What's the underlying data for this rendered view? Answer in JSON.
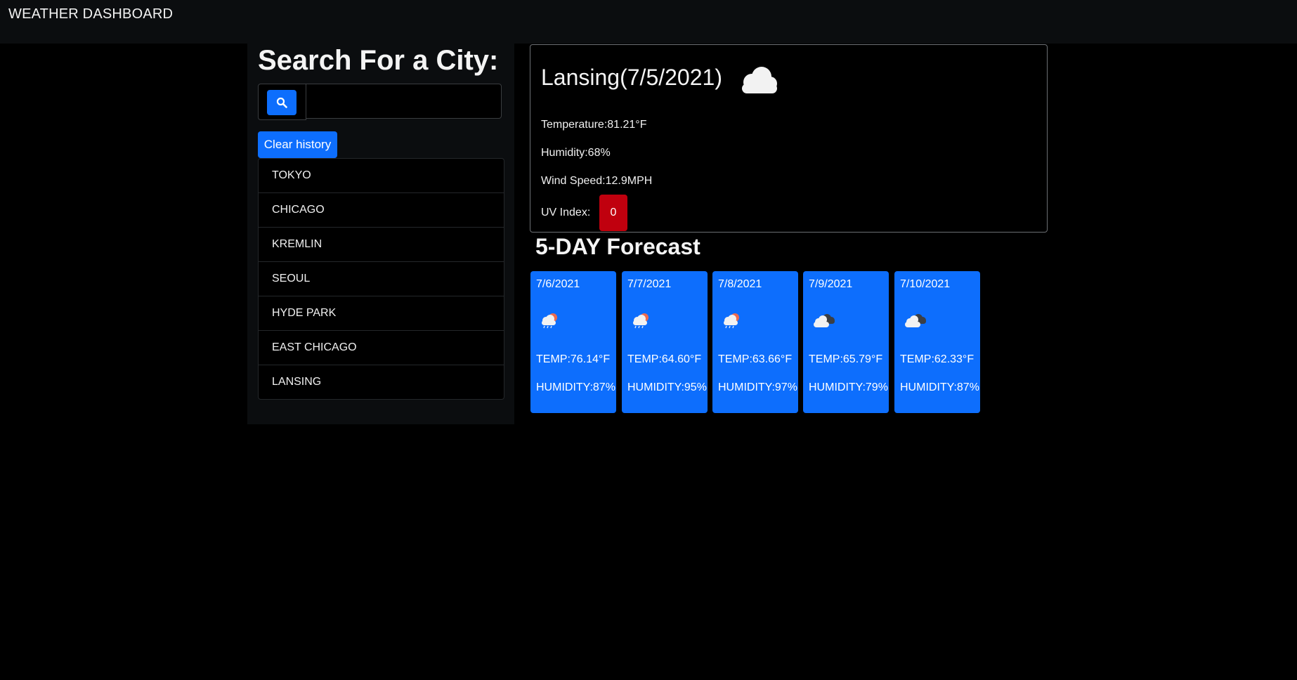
{
  "navbar": {
    "brand": "WEATHER DASHBOARD"
  },
  "sidebar": {
    "title": "Search For a City:",
    "search": {
      "icon": "search-icon",
      "value": "",
      "placeholder": ""
    },
    "clear_label": "Clear history",
    "history": [
      "TOKYO",
      "CHICAGO",
      "KREMLIN",
      "SEOUL",
      "HYDE PARK",
      "EAST CHICAGO",
      "LANSING"
    ]
  },
  "current": {
    "title": "Lansing(7/5/2021)",
    "icon": "cloud-icon",
    "temperature": "Temperature:81.21°F",
    "humidity": "Humidity:68%",
    "wind": "Wind Speed:12.9MPH",
    "uv_label": "UV Index:",
    "uv_value": "0",
    "uv_color": "#c0000e"
  },
  "forecast": {
    "title": "5-DAY Forecast",
    "accent": "#0d6efd",
    "days": [
      {
        "date": "7/6/2021",
        "icon": "rain-sun-cloud-icon",
        "temp": "TEMP:76.14°F",
        "humidity": "HUMIDITY:87%"
      },
      {
        "date": "7/7/2021",
        "icon": "rain-sun-cloud-icon",
        "temp": "TEMP:64.60°F",
        "humidity": "HUMIDITY:95%"
      },
      {
        "date": "7/8/2021",
        "icon": "rain-sun-cloud-icon",
        "temp": "TEMP:63.66°F",
        "humidity": "HUMIDITY:97%"
      },
      {
        "date": "7/9/2021",
        "icon": "broken-clouds-icon",
        "temp": "TEMP:65.79°F",
        "humidity": "HUMIDITY:79%"
      },
      {
        "date": "7/10/2021",
        "icon": "broken-clouds-icon",
        "temp": "TEMP:62.33°F",
        "humidity": "HUMIDITY:87%"
      }
    ]
  }
}
